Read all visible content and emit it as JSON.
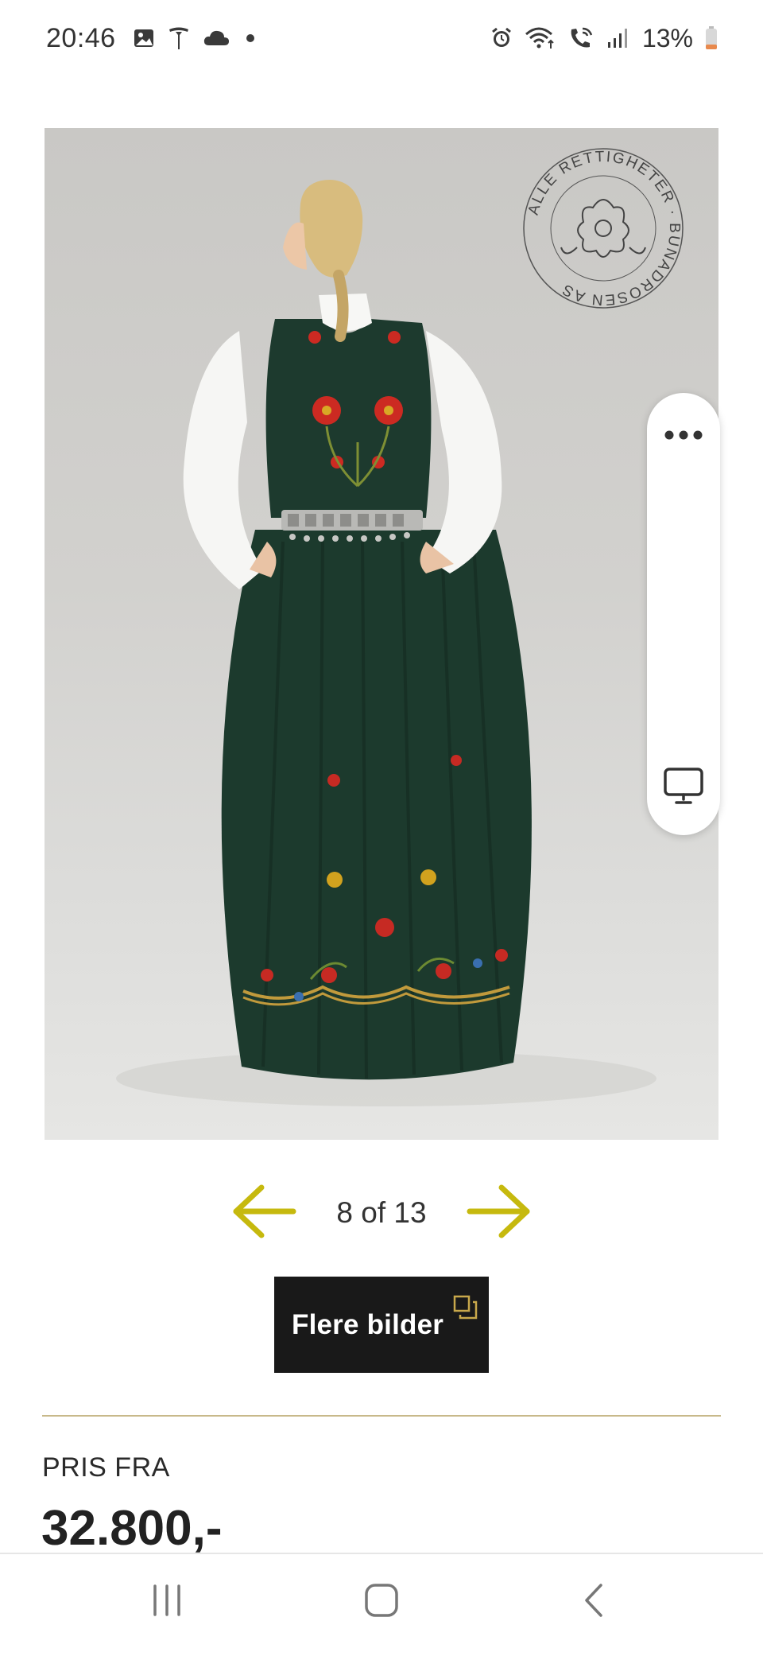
{
  "status_bar": {
    "time": "20:46",
    "battery": "13%",
    "left_icons": [
      "gallery-icon",
      "tesla-icon",
      "cloud-icon",
      "dot-icon"
    ],
    "right_icons": [
      "alarm-icon",
      "wifi-icon",
      "wifi-call-icon",
      "signal-icon",
      "battery-icon"
    ]
  },
  "product_image": {
    "watermark_text": "ALLE RETTIGHETER · BUNADROSEN AS",
    "watermark_icon": "rose-logo-icon"
  },
  "side_panel": {
    "top_icon": "more-dots-icon",
    "bottom_icon": "screen-icon"
  },
  "gallery": {
    "counter": "8 of 13",
    "prev_icon": "arrow-left-icon",
    "next_icon": "arrow-right-icon",
    "more_images_label": "Flere bilder",
    "more_images_icon": "gallery-stack-icon"
  },
  "price": {
    "label": "PRIS FRA",
    "value": "32.800,-"
  },
  "bottom_nav": {
    "icons": [
      "recent-apps-icon",
      "home-icon",
      "back-icon"
    ]
  },
  "colors": {
    "accent": "#c6b90e",
    "divider": "#c8b98a",
    "button_bg": "#191919",
    "dress_green": "#1d3a2e"
  }
}
